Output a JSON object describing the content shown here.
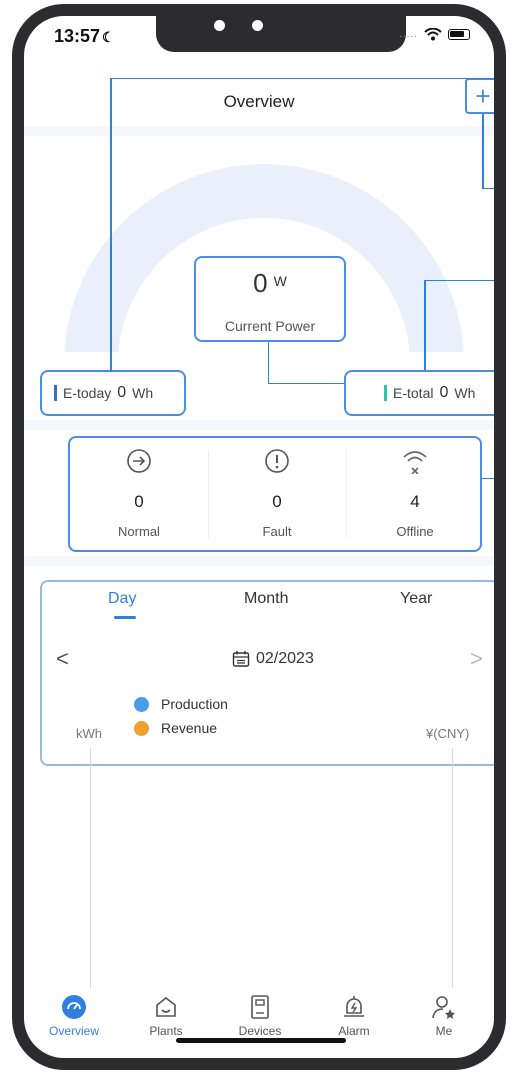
{
  "status_bar": {
    "time": "13:57",
    "moon": "☾"
  },
  "header": {
    "title": "Overview",
    "add_symbol": "+"
  },
  "power": {
    "value": "0",
    "unit": "W",
    "label": "Current Power"
  },
  "energy": {
    "today": {
      "label": "E-today",
      "value": "0",
      "unit": "Wh",
      "color": "#2f6fd6"
    },
    "total": {
      "label": "E-total",
      "value": "0",
      "unit": "Wh",
      "color": "#2ec4a8"
    }
  },
  "device_status": [
    {
      "icon": "arrow-circle-icon",
      "count": "0",
      "label": "Normal"
    },
    {
      "icon": "alert-circle-icon",
      "count": "0",
      "label": "Fault"
    },
    {
      "icon": "wifi-off-icon",
      "count": "4",
      "label": "Offline"
    }
  ],
  "chart_panel": {
    "tabs": [
      "Day",
      "Month",
      "Year"
    ],
    "active_tab": "Day",
    "prev": "<",
    "next": ">",
    "date": "02/2023",
    "legend": [
      {
        "label": "Production",
        "color": "#4a9be8"
      },
      {
        "label": "Revenue",
        "color": "#f0a030"
      }
    ],
    "left_unit": "kWh",
    "right_unit": "¥(CNY)"
  },
  "bottom_nav": [
    {
      "icon": "gauge-icon",
      "label": "Overview",
      "active": true
    },
    {
      "icon": "house-icon",
      "label": "Plants"
    },
    {
      "icon": "device-icon",
      "label": "Devices"
    },
    {
      "icon": "bell-icon",
      "label": "Alarm"
    },
    {
      "icon": "person-star-icon",
      "label": "Me"
    }
  ],
  "colors": {
    "accent": "#2f7fe0",
    "highlight_border": "#4a8ee0"
  }
}
